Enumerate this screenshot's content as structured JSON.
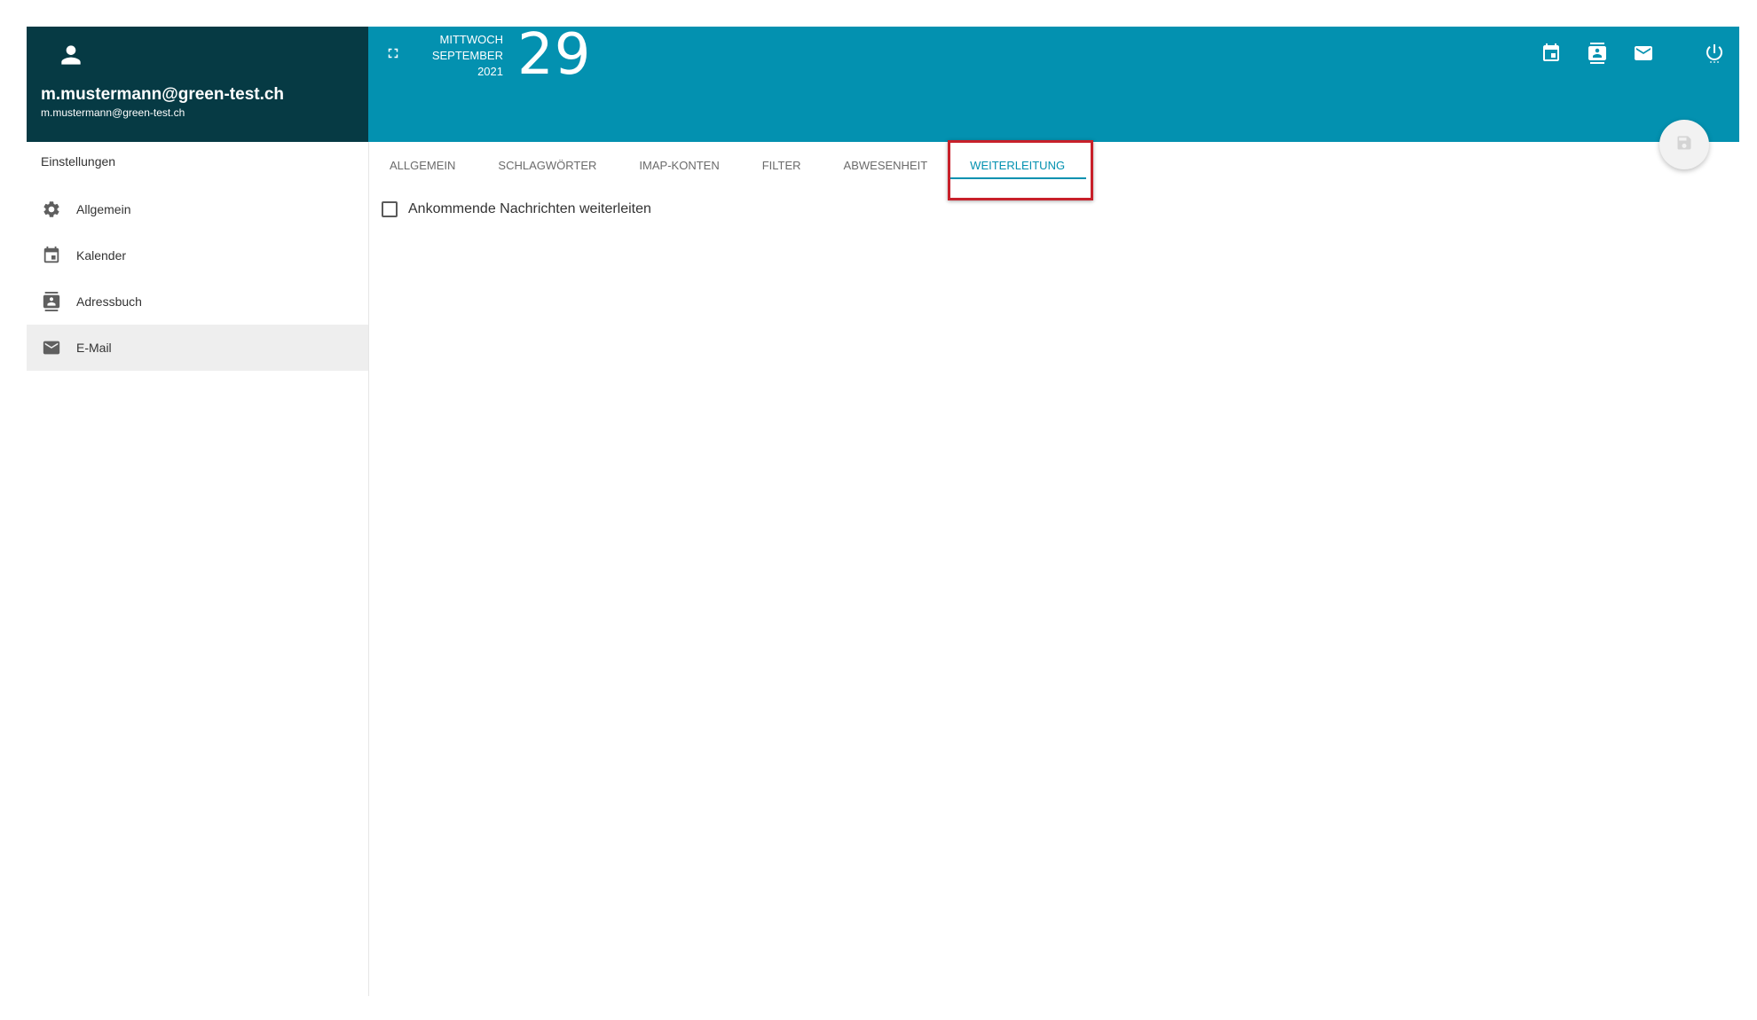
{
  "user": {
    "name": "m.mustermann@green-test.ch",
    "email": "m.mustermann@green-test.ch"
  },
  "sidebar": {
    "section_title": "Einstellungen",
    "items": [
      {
        "label": "Allgemein",
        "icon": "gear-icon",
        "active": false
      },
      {
        "label": "Kalender",
        "icon": "calendar-icon",
        "active": false
      },
      {
        "label": "Adressbuch",
        "icon": "contact-book-icon",
        "active": false
      },
      {
        "label": "E-Mail",
        "icon": "mail-icon",
        "active": true
      }
    ]
  },
  "header": {
    "weekday": "MITTWOCH",
    "month": "SEPTEMBER",
    "year": "2021",
    "day": "29",
    "actions": [
      "calendar-icon",
      "contact-icon",
      "mail-icon",
      "power-icon"
    ]
  },
  "tabs": [
    {
      "label": "ALLGEMEIN",
      "active": false
    },
    {
      "label": "SCHLAGWÖRTER",
      "active": false
    },
    {
      "label": "IMAP-KONTEN",
      "active": false
    },
    {
      "label": "FILTER",
      "active": false
    },
    {
      "label": "ABWESENHEIT",
      "active": false
    },
    {
      "label": "WEITERLEITUNG",
      "active": true
    }
  ],
  "content": {
    "forward_checkbox_label": "Ankommende Nachrichten weiterleiten",
    "forward_checked": false
  },
  "colors": {
    "user_card_bg": "#063a44",
    "header_bg": "#0391b0",
    "accent": "#0391b0",
    "highlight_border": "#c8202a",
    "active_nav_bg": "#eeeeee"
  }
}
